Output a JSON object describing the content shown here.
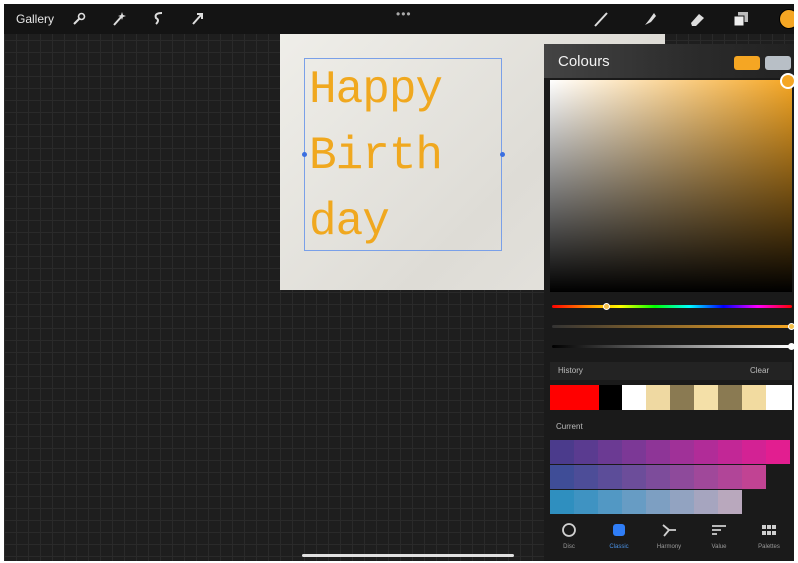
{
  "topbar": {
    "gallery_label": "Gallery",
    "more_label": "•••",
    "left_tools": [
      "wrench-icon",
      "magic-wand-icon",
      "selection-icon",
      "transform-arrow-icon"
    ],
    "right_tools": [
      "brush-icon",
      "smudge-icon",
      "eraser-icon",
      "layers-icon"
    ],
    "current_color": "#f5a623"
  },
  "canvas": {
    "text_lines": [
      "Happy",
      "Birth",
      "day"
    ],
    "text_color": "#f0a81f"
  },
  "colours": {
    "title": "Colours",
    "primary_color": "#f5a623",
    "secondary_color": "#b8bfc6",
    "history_label": "History",
    "clear_label": "Clear",
    "history": [
      {
        "color": "#ff0000",
        "width": 49
      },
      {
        "color": "#000000",
        "width": 23
      },
      {
        "color": "#ffffff",
        "width": 24
      },
      {
        "color": "#efd9a2",
        "width": 24
      },
      {
        "color": "#8a7a52",
        "width": 24
      },
      {
        "color": "#f4e0a8",
        "width": 24
      },
      {
        "color": "#8a7a52",
        "width": 24
      },
      {
        "color": "#f2dba0",
        "width": 24
      },
      {
        "color": "#ffffff",
        "width": 26
      }
    ],
    "palette_label": "Current",
    "palette_rows": [
      [
        "#4b3b8c",
        "#5a3b90",
        "#6b3a93",
        "#7c3896",
        "#8e3597",
        "#a03198",
        "#b12c98",
        "#c22796",
        "#d32294",
        "#e21e90"
      ],
      [
        "#3f4d97",
        "#4d4d98",
        "#5c4d99",
        "#6c4d9a",
        "#7d4c9b",
        "#8e4a9b",
        "#a0489a",
        "#b14598",
        "#c14393"
      ],
      [
        "#2f8fbf",
        "#3f93c2",
        "#5298c4",
        "#679cc4",
        "#7d9fc2",
        "#92a3c1",
        "#a6a5bf",
        "#b9a8bd"
      ]
    ],
    "tabs": [
      {
        "label": "Disc",
        "icon": "disc-icon"
      },
      {
        "label": "Classic",
        "icon": "classic-icon"
      },
      {
        "label": "Harmony",
        "icon": "harmony-icon"
      },
      {
        "label": "Value",
        "icon": "value-icon"
      },
      {
        "label": "Palettes",
        "icon": "palettes-icon"
      }
    ],
    "active_tab": "Classic",
    "hue_fraction": 0.23,
    "saturation_fraction": 1.0,
    "brightness_fraction": 1.0
  }
}
